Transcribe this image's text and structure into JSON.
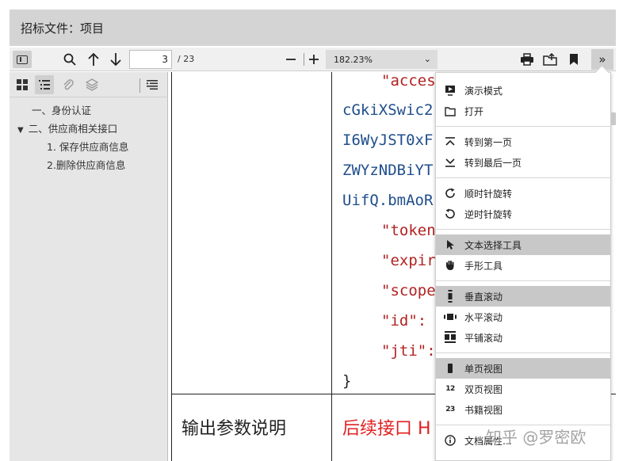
{
  "window": {
    "title": "招标文件：项目"
  },
  "toolbar": {
    "page_value": "3",
    "page_count": "/ 23",
    "zoom_level": "182.23%",
    "zoom_out": "—",
    "zoom_in": "+"
  },
  "sidebar": {
    "outline": [
      {
        "label": "一、身份认证"
      },
      {
        "label": "二、供应商相关接口",
        "expanded": true
      },
      {
        "label": "1. 保存供应商信息"
      },
      {
        "label": "2.删除供应商信息"
      }
    ]
  },
  "document": {
    "code_lines": [
      {
        "text": "\"acces",
        "kind": "key"
      },
      {
        "text": "cGkiXSwic2",
        "kind": "val"
      },
      {
        "text": "I6WyJST0xF",
        "kind": "val"
      },
      {
        "text": "ZWYzNDBiYT",
        "kind": "val"
      },
      {
        "text": "UifQ.bmAoR",
        "kind": "val"
      },
      {
        "text": "\"token",
        "kind": "key"
      },
      {
        "text": "\"expir",
        "kind": "key"
      },
      {
        "text": "\"scope",
        "kind": "key"
      },
      {
        "text": "\"id\":",
        "kind": "key"
      },
      {
        "text": "\"jti\":",
        "kind": "key"
      },
      {
        "text": "}",
        "kind": "brace"
      }
    ],
    "output_label": "输出参数说明",
    "output_value": "后续接口 H"
  },
  "menu": {
    "items": [
      {
        "label": "演示模式",
        "icon": "presentation-icon"
      },
      {
        "label": "打开",
        "icon": "open-file-icon"
      },
      {
        "label": "转到第一页",
        "icon": "first-page-icon"
      },
      {
        "label": "转到最后一页",
        "icon": "last-page-icon"
      },
      {
        "label": "顺时针旋转",
        "icon": "rotate-cw-icon"
      },
      {
        "label": "逆时针旋转",
        "icon": "rotate-ccw-icon"
      },
      {
        "label": "文本选择工具",
        "icon": "cursor-icon",
        "selected": true
      },
      {
        "label": "手形工具",
        "icon": "hand-icon"
      },
      {
        "label": "垂直滚动",
        "icon": "vertical-scroll-icon",
        "selected": true
      },
      {
        "label": "水平滚动",
        "icon": "horizontal-scroll-icon"
      },
      {
        "label": "平铺滚动",
        "icon": "wrapped-scroll-icon"
      },
      {
        "label": "单页视图",
        "icon": "single-page-icon",
        "selected": true
      },
      {
        "label": "双页视图",
        "icon": "dual-page-icon"
      },
      {
        "label": "书籍视图",
        "icon": "book-view-icon"
      },
      {
        "label": "文档属性…",
        "icon": "info-icon"
      }
    ],
    "icon_text": {
      "dual": "12",
      "book": "23"
    }
  },
  "watermark": "知乎 @罗密欧",
  "colors": {
    "key": "#b22222",
    "value": "#1f4e8c",
    "output": "#e02020",
    "selected": "#c8c8c8"
  }
}
